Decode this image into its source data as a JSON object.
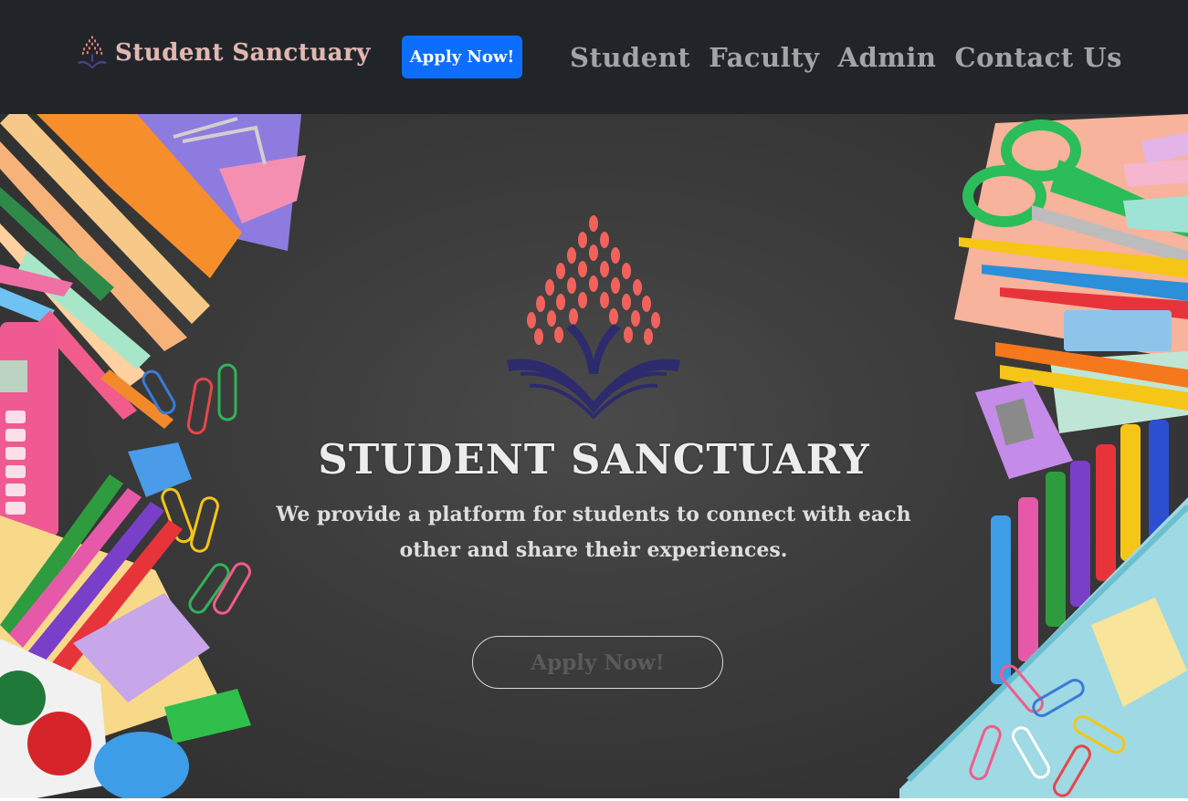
{
  "navbar": {
    "brand_name": "Student Sanctuary",
    "apply_label": "Apply Now!",
    "links": [
      "Student",
      "Faculty",
      "Admin",
      "Contact Us"
    ]
  },
  "hero": {
    "title": "STUDENT SANCTUARY",
    "description": "We provide a platform for students to connect with each other and share their experiences.",
    "cta_label": "Apply Now!"
  },
  "colors": {
    "navbar_bg": "#212529",
    "primary_button": "#0d6efd",
    "logo_leaf": "#f2625c",
    "logo_book": "#2d2a6e",
    "brand_text": "#e3b7b0"
  },
  "icons": {
    "brand": "tree-book-logo-icon",
    "hero": "tree-book-logo-icon"
  }
}
